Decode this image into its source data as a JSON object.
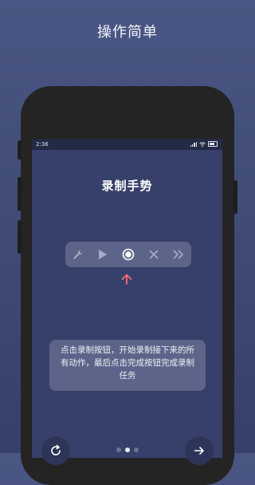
{
  "promo": {
    "title": "操作简单"
  },
  "status_bar": {
    "time": "2:36"
  },
  "screen": {
    "title": "录制手势",
    "toolbar": [
      {
        "icon": "wrench-icon"
      },
      {
        "icon": "play-icon"
      },
      {
        "icon": "record-icon"
      },
      {
        "icon": "close-icon"
      },
      {
        "icon": "fast-forward-icon"
      }
    ],
    "hint": "点击录制按钮，开始录制接下来的所有动作，最后点击完成按钮完成录制任务"
  },
  "pager": {
    "count": 3,
    "active": 1
  },
  "colors": {
    "background": "#434e7c",
    "card": "#5c6589",
    "arrow": "#ff6b6b"
  }
}
